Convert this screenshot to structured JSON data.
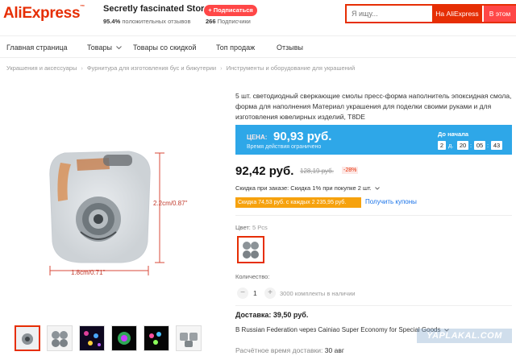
{
  "header": {
    "logo": "AliExpress",
    "store_name": "Secretly fascinated Store",
    "rating_value": "95.4%",
    "rating_text": "положительных отзывов",
    "subscribe_label": "+ Подписаться",
    "followers_count": "266",
    "followers_text": "Подписчики",
    "search_placeholder": "Я ищу...",
    "search_ali_label": "На AliExpress",
    "search_store_label": "В этом"
  },
  "nav": {
    "items": [
      "Главная страница",
      "Товары",
      "Товары со скидкой",
      "Топ продаж",
      "Отзывы"
    ],
    "dropdown_icon": "chevron-down-icon"
  },
  "breadcrumb": [
    "Украшения и аксессуары",
    "Фурнитура для изготовления бус и бижутерии",
    "Инструменты и оборудование для украшений"
  ],
  "image": {
    "dim_width": "1.8cm/0.71\"",
    "dim_height": "2.2cm/0.87\""
  },
  "product": {
    "title": "5 шт. светодиодный сверкающие смолы пресс-форма наполнитель эпоксидная смола, форма для наполнения Материал украшения для поделки своими руками и для изготовления ювелирных изделий, T8DE",
    "promo_label": "ЦЕНА:",
    "promo_price": "90,93 руб.",
    "promo_note": "Время действия ограничено",
    "countdown_label": "До начала",
    "countdown": {
      "days": "2",
      "d_label": "д.",
      "hours": "20",
      "minutes": "05",
      "seconds": "43"
    },
    "price": "92,42 руб.",
    "old_price": "128,19 руб.",
    "discount": "-28%",
    "order_discount": "Скидка при заказе: Скидка 1% при покупке 2 шт.",
    "coupon": "Скидка 74,53 руб. с каждых 2 235,95 руб.",
    "coupon_link": "Получить купоны",
    "color_label": "Цвет:",
    "color_value": "5 Pcs",
    "qty_label": "Количество:",
    "qty_value": "1",
    "qty_stock": "3000 комплекты в наличии",
    "delivery": "Доставка: 39,50 руб.",
    "delivery_route": "В Russian Federation через Cainiao Super Economy for Special Goods",
    "delivery_time_label": "Расчётное время доставки:",
    "delivery_time_value": "30 авг"
  },
  "watermark": "YAPLAKAL.COM",
  "colors": {
    "brand": "#e62e04",
    "promo": "#2ea7e8",
    "coupon": "#f6a20e",
    "link": "#1a73e8"
  }
}
